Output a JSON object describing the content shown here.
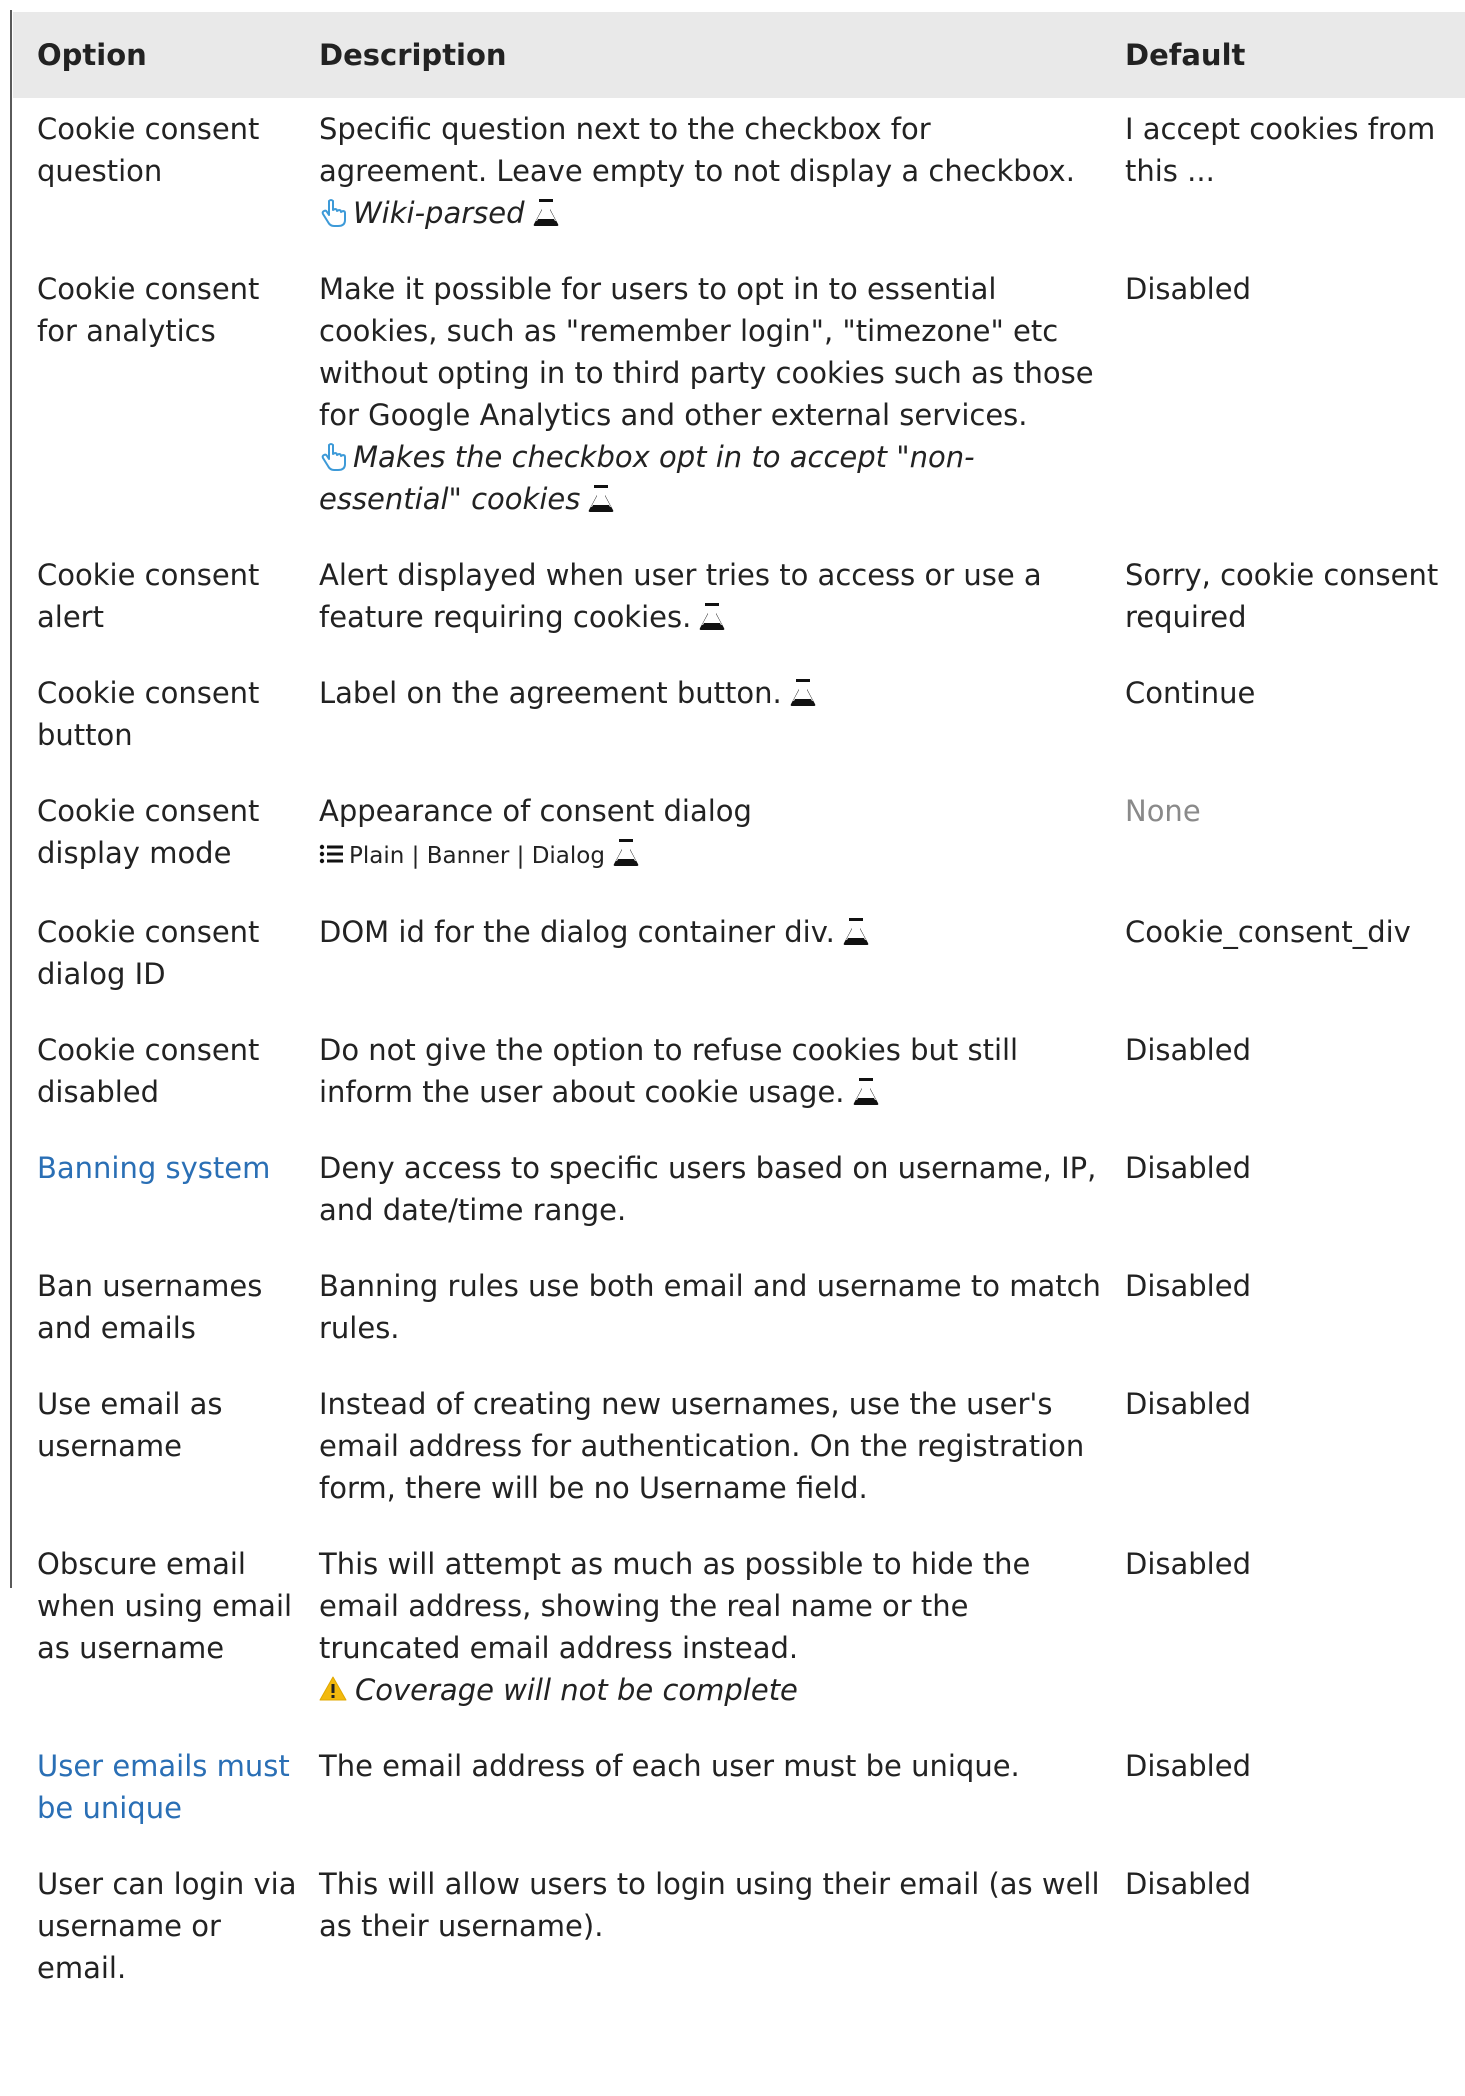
{
  "table": {
    "headers": {
      "option": "Option",
      "description": "Description",
      "default": "Default"
    },
    "rows": [
      {
        "option": "Cookie consent question",
        "description": "Specific question next to the checkbox for agreement. Leave empty to not display a checkbox.",
        "note": "Wiki-parsed",
        "default": "I accept cookies from this ..."
      },
      {
        "option": "Cookie consent for analytics",
        "description": "Make it possible for users to opt in to essential cookies, such as \"remember login\", \"timezone\" etc without opting in to third party cookies such as those for Google Analytics and other external services.",
        "note": "Makes the checkbox opt in to accept \"non-essential\" cookies",
        "default": "Disabled"
      },
      {
        "option": "Cookie consent alert",
        "description": "Alert displayed when user tries to access or use a feature requiring cookies.",
        "default": "Sorry, cookie consent required"
      },
      {
        "option": "Cookie consent button",
        "description": "Label on the agreement button.",
        "default": "Continue"
      },
      {
        "option": "Cookie consent display mode",
        "description": "Appearance of consent dialog",
        "options_list": "Plain | Banner | Dialog",
        "default": "None"
      },
      {
        "option": "Cookie consent dialog ID",
        "description": "DOM id for the dialog container div.",
        "default": "Cookie_consent_div"
      },
      {
        "option": "Cookie consent disabled",
        "description": "Do not give the option to refuse cookies but still inform the user about cookie usage.",
        "default": "Disabled"
      },
      {
        "option": "Banning system",
        "description": "Deny access to specific users based on username, IP, and date/time range.",
        "default": "Disabled"
      },
      {
        "option": "Ban usernames and emails",
        "description": "Banning rules use both email and username to match rules.",
        "default": "Disabled"
      },
      {
        "option": "Use email as username",
        "description": "Instead of creating new usernames, use the user's email address for authentication. On the registration form, there will be no Username field.",
        "default": "Disabled"
      },
      {
        "option": "Obscure email when using email as username",
        "description": "This will attempt as much as possible to hide the email address, showing the real name or the truncated email address instead.",
        "warning": "Coverage will not be complete",
        "default": "Disabled"
      },
      {
        "option": "User emails must be unique",
        "description": "The email address of each user must be unique.",
        "default": "Disabled"
      },
      {
        "option": "User can login via username or email.",
        "description": "This will allow users to login using their email (as well as their username).",
        "default": "Disabled"
      }
    ]
  },
  "icons": {
    "hand": "pointing-hand-icon",
    "flask": "experimental-flask-icon",
    "warning": "warning-icon",
    "list": "list-icon"
  },
  "colors": {
    "link": "#2a6fb5",
    "header_bg": "#e9e9e9",
    "warning": "#f2b90d",
    "hand": "#3d9ad8"
  }
}
